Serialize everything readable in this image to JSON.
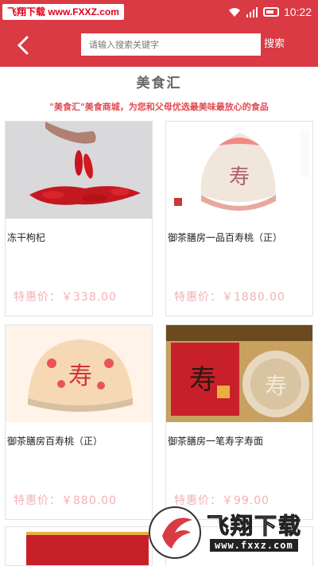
{
  "statusbar": {
    "watermark": "飞翔下载 www.FXXZ.com",
    "time": "10:22"
  },
  "header": {
    "search_placeholder": "请输入搜索关键字",
    "search_button": "搜索"
  },
  "section": {
    "title": "美食汇",
    "slogan": "\"美食汇\"美食商城，为您和父母优选最美味最放心的食品"
  },
  "products": [
    {
      "name": "冻干枸杞",
      "price": "特惠价：￥338.00"
    },
    {
      "name": "御茶膳房一品百寿桃（正）",
      "price": "特惠价：￥1880.00"
    },
    {
      "name": "御茶膳房百寿桃（正）",
      "price": "特惠价：￥880.00"
    },
    {
      "name": "御茶膳房一笔寿字寿面",
      "price": "特惠价：￥99.00"
    }
  ],
  "brand_watermark": {
    "name": "飞翔下载",
    "url": "www.fxxz.com"
  },
  "colors": {
    "accent": "#d93a44",
    "price": "#f4b0b4"
  },
  "icons": [
    "wifi-icon",
    "signal-icon",
    "battery-icon",
    "back-arrow-icon"
  ]
}
